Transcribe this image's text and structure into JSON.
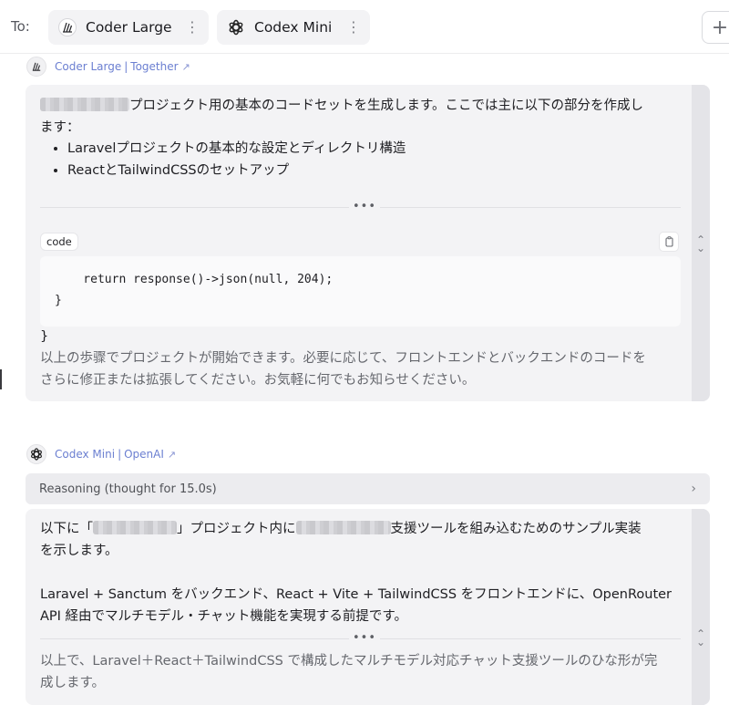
{
  "to_label": "To:",
  "models": [
    {
      "name": "Coder Large",
      "icon": "coder-large-logo-icon"
    },
    {
      "name": "Codex Mini",
      "icon": "openai-logo-icon"
    }
  ],
  "add_button": "+",
  "responses": [
    {
      "model": "Coder Large",
      "provider": "Together",
      "para1_a": "プロジェクト用の基本のコードセットを生成します。ここでは主に以下の部分を作成し",
      "para1_b": "ます：",
      "bullets": [
        "Laravelプロジェクトの基本的な設定とディレクトリ構造",
        "ReactとTailwindCSSのセットアップ"
      ],
      "ellipsis": "•••",
      "code_label": "code",
      "code_lines": [
        "    return response()->json(null, 204);",
        "}"
      ],
      "closing_brace": "}",
      "outro_a": "以上の歩骤でプロジェクトが開始できます。必要に応じて、フロントエンドとバックエンドのコードを",
      "outro_b": "さらに修正または拡張してください。お気軽に何でもお知らせください。"
    },
    {
      "model": "Codex Mini",
      "provider": "OpenAI",
      "reasoning": "Reasoning (thought for 15.0s)",
      "p1_a1": "以下に「",
      "p1_a2": "」プロジェクト内に",
      "p1_a3": "支援ツールを組み込むためのサンプル実装",
      "p1_b": "を示します。",
      "p2_a": "Laravel + Sanctum をバックエンド、React + Vite + TailwindCSS をフロントエンドに、OpenRouter",
      "p2_b": "API 経由でマルチモデル・チャット機能を実現する前提です。",
      "ellipsis": "•••",
      "outro_a": "以上で、Laravel＋React＋TailwindCSS で構成したマルチモデル対応チャット支援ツールのひな形が完",
      "outro_b": "成します。"
    }
  ],
  "colors": {
    "link": "#6b7fd1",
    "card": "#f3f3f5",
    "rail": "#e4e4e8"
  }
}
